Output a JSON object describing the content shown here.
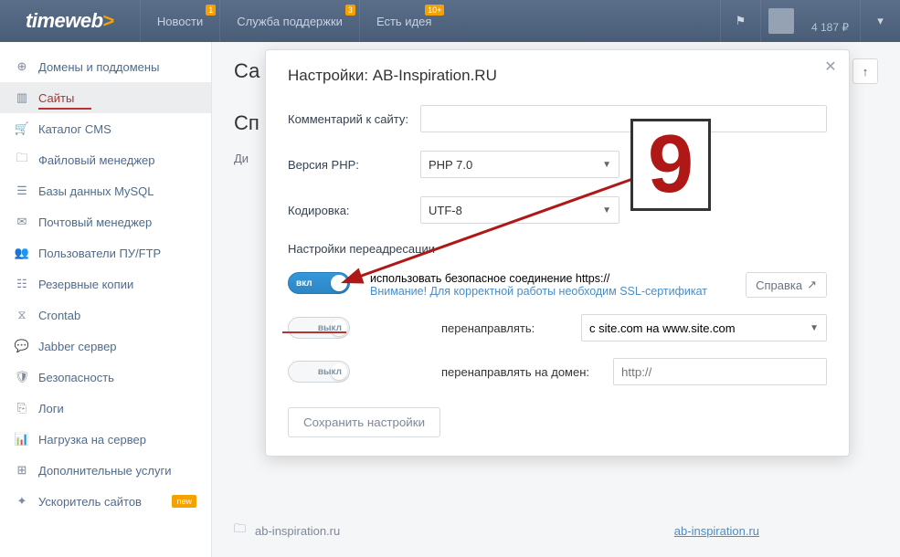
{
  "brand": {
    "name": "timeweb",
    "chevron": ">"
  },
  "topnav": {
    "news": {
      "label": "Новости",
      "badge": "1"
    },
    "support": {
      "label": "Служба поддержки",
      "badge": "3"
    },
    "idea": {
      "label": "Есть идея",
      "badge": "10+"
    }
  },
  "account": {
    "balance": "4 187 ₽"
  },
  "sidebar": {
    "items": [
      {
        "label": "Домены и поддомены"
      },
      {
        "label": "Сайты"
      },
      {
        "label": "Каталог CMS"
      },
      {
        "label": "Файловый менеджер"
      },
      {
        "label": "Базы данных MySQL"
      },
      {
        "label": "Почтовый менеджер"
      },
      {
        "label": "Пользователи ПУ/FTP"
      },
      {
        "label": "Резервные копии"
      },
      {
        "label": "Crontab"
      },
      {
        "label": "Jabber сервер"
      },
      {
        "label": "Безопасность"
      },
      {
        "label": "Логи"
      },
      {
        "label": "Нагрузка на сервер"
      },
      {
        "label": "Дополнительные услуги"
      },
      {
        "label": "Ускоритель сайтов",
        "badge": "new"
      }
    ]
  },
  "page": {
    "title_partial1": "Са",
    "title_partial2": "Сп",
    "col_label": "Ди"
  },
  "site_row": {
    "folder": "ab-inspiration.ru",
    "link": "ab-inspiration.ru"
  },
  "modal": {
    "title": "Настройки: AB-Inspiration.RU",
    "comment_label": "Комментарий к сайту:",
    "php_label": "Версия PHP:",
    "php_value": "PHP 7.0",
    "encoding_label": "Кодировка:",
    "encoding_value": "UTF-8",
    "redirect_section": "Настройки переадресации",
    "https_on": "вкл",
    "https_desc": "использовать безопасное соединение https://",
    "https_warn": "Внимание! Для корректной работы необходим SSL-сертификат",
    "help_btn": "Справка",
    "www_off": "выкл",
    "www_label": "перенаправлять:",
    "www_value": "с site.com на www.site.com",
    "domain_off": "выкл",
    "domain_label": "перенаправлять на домен:",
    "domain_placeholder": "http://",
    "save": "Сохранить настройки"
  },
  "annotation": {
    "number": "9"
  }
}
